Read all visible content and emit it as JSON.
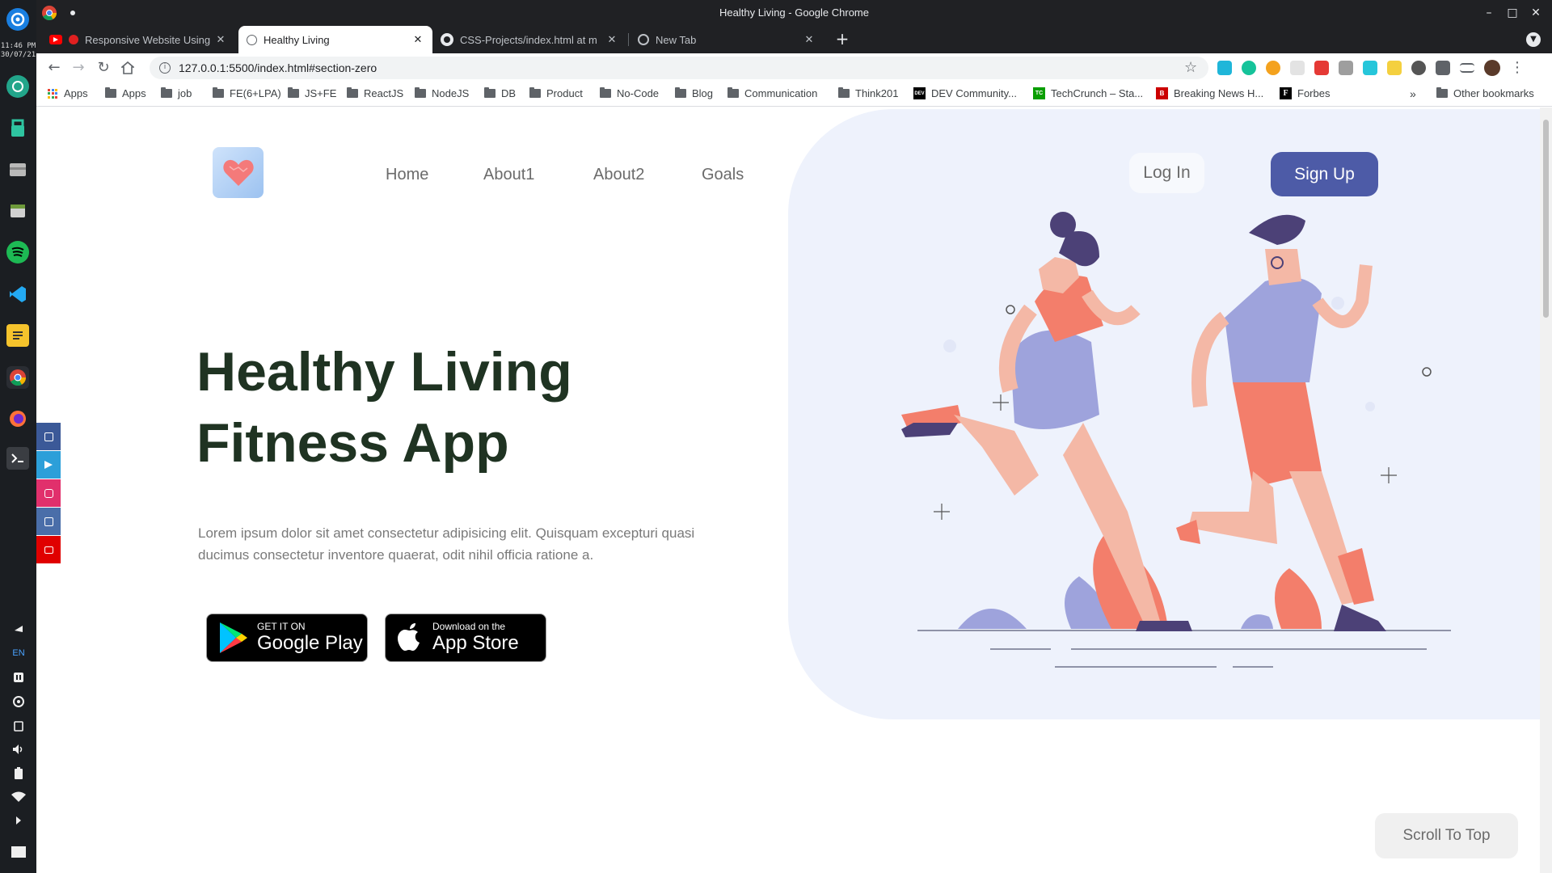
{
  "window": {
    "title": "Healthy Living - Google Chrome"
  },
  "dock": {
    "time": "11:46 PM",
    "date": "30/07/21",
    "lang": "EN",
    "icons": [
      "settings-app-icon",
      "ftp-icon",
      "bag-icon",
      "files-icon",
      "spotify-icon",
      "vscode-icon",
      "notes-icon",
      "chrome-icon",
      "firefox-icon",
      "terminal-icon"
    ],
    "tray": [
      "notification-icon",
      "pause-icon",
      "sync-icon",
      "clipboard-icon",
      "volume-icon",
      "battery-icon",
      "wifi-icon",
      "expand-icon"
    ]
  },
  "tabs": [
    {
      "label": "Responsive Website Using",
      "favicon": "youtube-icon",
      "active": false
    },
    {
      "label": "Healthy Living",
      "favicon": "globe-icon",
      "active": true
    },
    {
      "label": "CSS-Projects/index.html at m",
      "favicon": "github-icon",
      "active": false
    },
    {
      "label": "New Tab",
      "favicon": "chrome-icon",
      "active": false
    }
  ],
  "toolbar": {
    "url": "127.0.0.1:5500/index.html#section-zero"
  },
  "bookmarks": {
    "items": [
      {
        "label": "Apps",
        "type": "apps"
      },
      {
        "label": "Apps",
        "type": "folder"
      },
      {
        "label": "job",
        "type": "folder"
      },
      {
        "label": "FE(6+LPA)",
        "type": "folder"
      },
      {
        "label": "JS+FE",
        "type": "folder"
      },
      {
        "label": "ReactJS",
        "type": "folder"
      },
      {
        "label": "NodeJS",
        "type": "folder"
      },
      {
        "label": "DB",
        "type": "folder"
      },
      {
        "label": "Product",
        "type": "folder"
      },
      {
        "label": "No-Code",
        "type": "folder"
      },
      {
        "label": "Blog",
        "type": "folder"
      },
      {
        "label": "Communication",
        "type": "folder"
      },
      {
        "label": "Think201",
        "type": "folder"
      },
      {
        "label": "DEV Community...",
        "type": "site",
        "badge": "DEV",
        "color": "#000000"
      },
      {
        "label": "TechCrunch – Sta...",
        "type": "site",
        "badge": "TC",
        "color": "#0a9e01"
      },
      {
        "label": "Breaking News H...",
        "type": "site",
        "badge": "B",
        "color": "#cc0000"
      },
      {
        "label": "Forbes",
        "type": "site",
        "badge": "F",
        "color": "#000000"
      }
    ],
    "other": "Other bookmarks"
  },
  "nav": {
    "links": [
      "Home",
      "About1",
      "About2",
      "Goals"
    ],
    "login": "Log In",
    "signup": "Sign Up"
  },
  "hero": {
    "title_line1": "Healthy Living",
    "title_line2": "Fitness App",
    "text": "Lorem ipsum dolor sit amet consectetur adipisicing elit. Quisquam excepturi quasi ducimus consectetur inventore quaerat, odit nihil officia ratione a."
  },
  "stores": {
    "google": {
      "small": "GET IT ON",
      "big": "Google Play"
    },
    "apple": {
      "small": "Download on the",
      "big": "App Store"
    }
  },
  "social": [
    {
      "name": "facebook-icon",
      "color": "#3b5998"
    },
    {
      "name": "telegram-icon",
      "color": "#2c9fd9"
    },
    {
      "name": "instagram-icon",
      "color": "#e1306c"
    },
    {
      "name": "linkedin-icon",
      "color": "#4a6ea9"
    },
    {
      "name": "youtube-icon",
      "color": "#e00000"
    }
  ],
  "scroll_top": "Scroll To Top",
  "colors": {
    "accent": "#4d5ba7",
    "hero_bg": "#eef2fc",
    "title": "#1f3322",
    "coral": "#f37e6b",
    "lavender": "#9ea3dc"
  }
}
